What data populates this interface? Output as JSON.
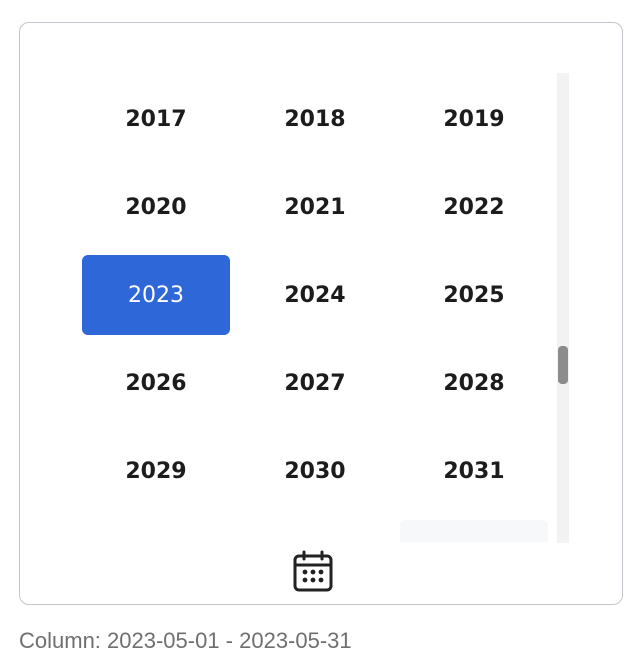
{
  "year_picker": {
    "years": [
      {
        "label": "2017",
        "selected": false
      },
      {
        "label": "2018",
        "selected": false
      },
      {
        "label": "2019",
        "selected": false
      },
      {
        "label": "2020",
        "selected": false
      },
      {
        "label": "2021",
        "selected": false
      },
      {
        "label": "2022",
        "selected": false
      },
      {
        "label": "2023",
        "selected": true
      },
      {
        "label": "2024",
        "selected": false
      },
      {
        "label": "2025",
        "selected": false
      },
      {
        "label": "2026",
        "selected": false
      },
      {
        "label": "2027",
        "selected": false
      },
      {
        "label": "2028",
        "selected": false
      },
      {
        "label": "2029",
        "selected": false
      },
      {
        "label": "2030",
        "selected": false
      },
      {
        "label": "2031",
        "selected": false
      }
    ],
    "selected_color": "#2e67d8",
    "toggle_icon": "calendar-icon"
  },
  "caption": {
    "text": "Column: 2023-05-01 - 2023-05-31"
  }
}
